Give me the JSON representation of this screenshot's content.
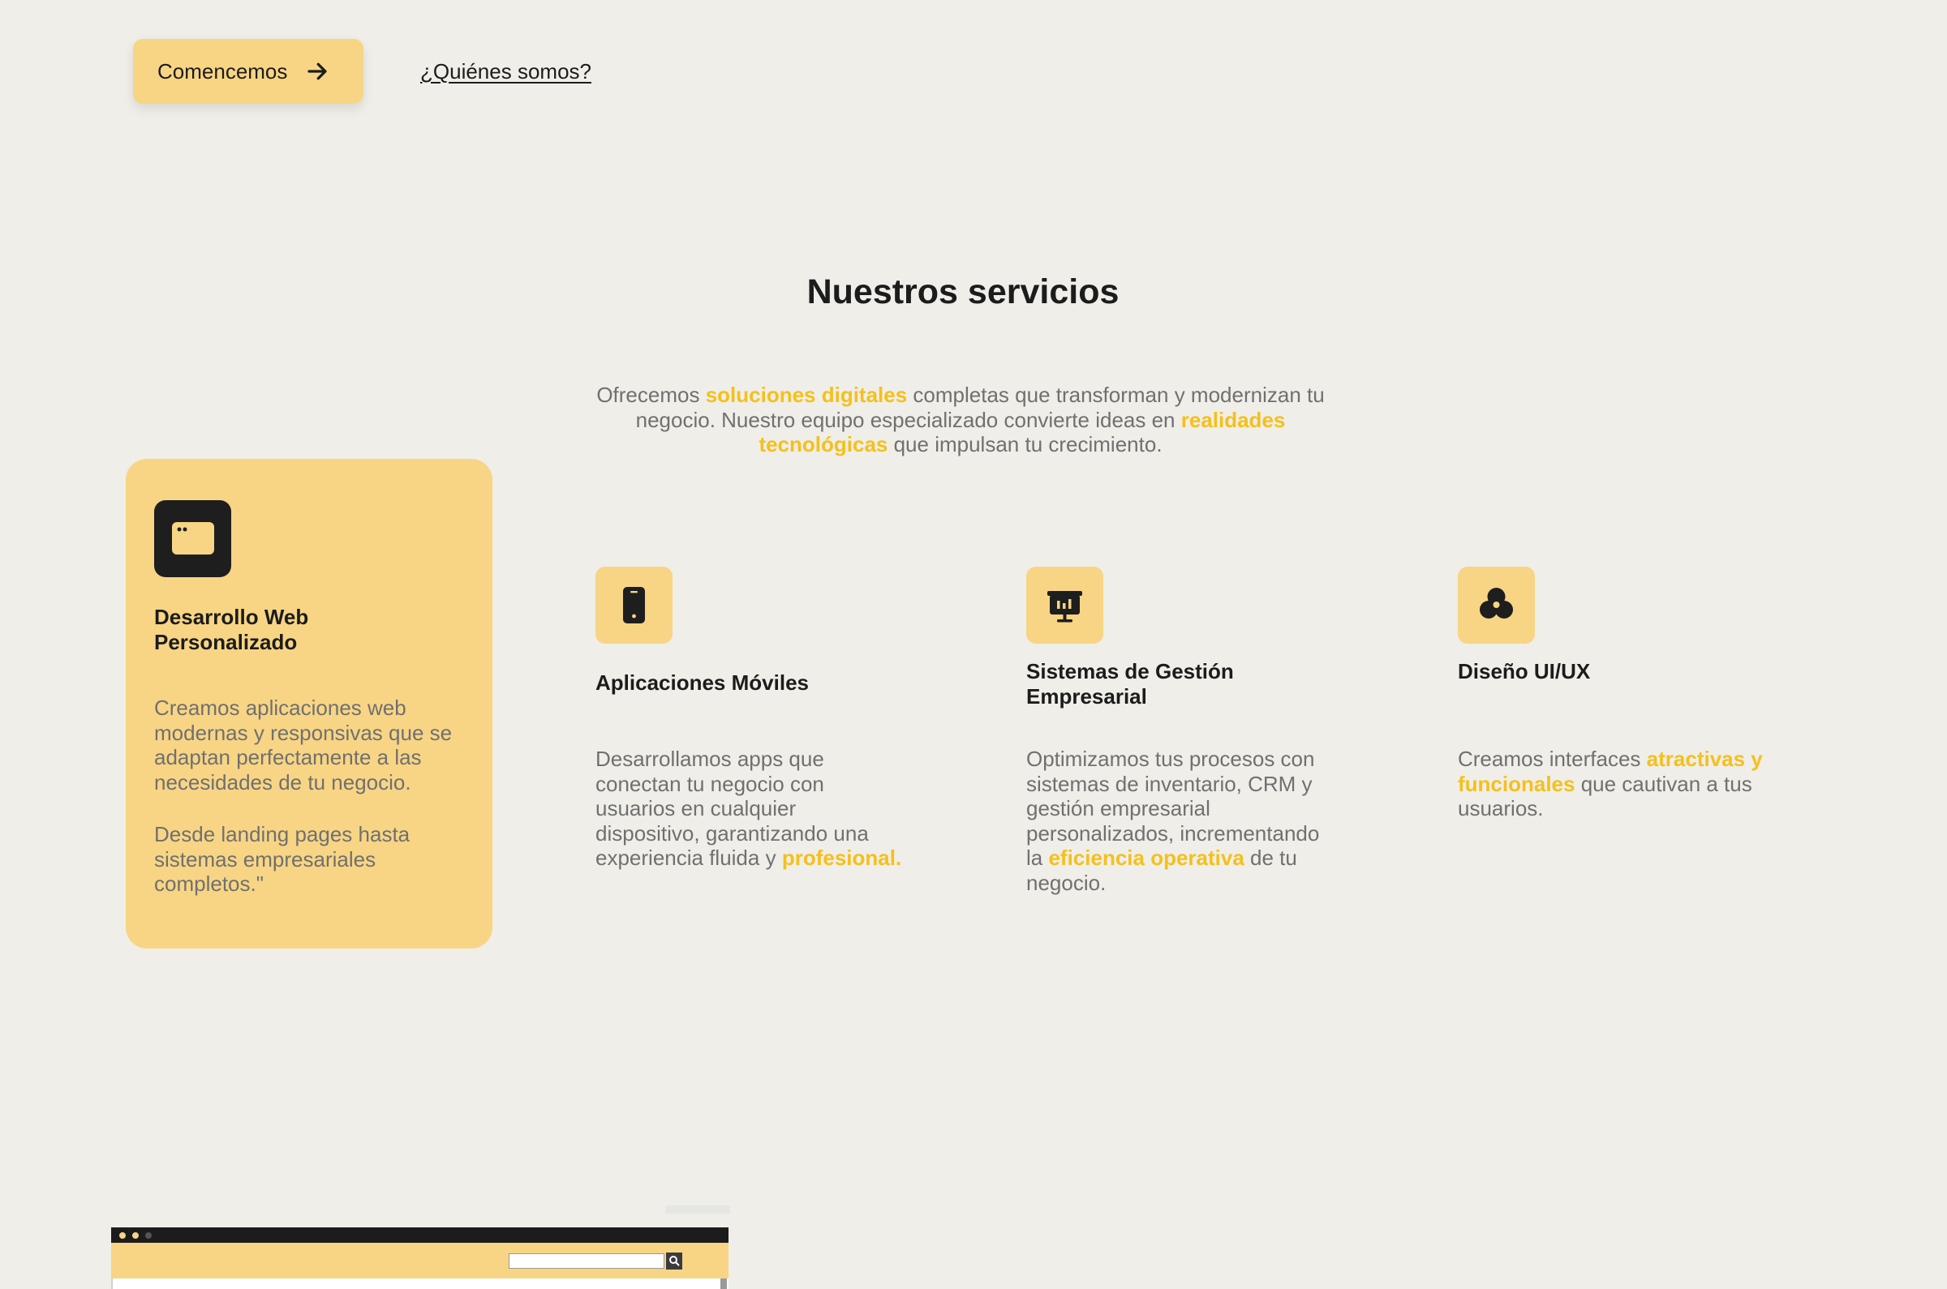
{
  "hero": {
    "primary_button": "Comencemos",
    "secondary_link": "¿Quiénes somos?"
  },
  "services": {
    "title": "Nuestros servicios",
    "intro": {
      "t1": "Ofrecemos ",
      "h1": "soluciones digitales",
      "t2": " completas que transforman y modernizan tu negocio. Nuestro equipo especializado convierte ideas en ",
      "h2": "realidades tecnológicas",
      "t3": " que impulsan tu crecimiento."
    },
    "items": [
      {
        "icon": "browser-window-icon",
        "title": "Desarrollo Web Personalizado",
        "desc1": "Creamos aplicaciones web modernas y responsivas que se adaptan perfectamente a las necesidades de tu negocio.",
        "desc2": "Desde landing pages hasta sistemas empresariales completos.\""
      },
      {
        "icon": "mobile-phone-icon",
        "title": "Aplicaciones Móviles",
        "t1": "Desarrollamos apps que conectan tu negocio con usuarios en cualquier dispositivo, garantizando una experiencia fluida y ",
        "h1": "profesional."
      },
      {
        "icon": "presentation-chart-icon",
        "title": "Sistemas de Gestión Empresarial",
        "t1": "Optimizamos tus procesos con sistemas de inventario, CRM y gestión empresarial personalizados, incrementando la ",
        "h1": "eficiencia operativa",
        "t2": " de tu negocio."
      },
      {
        "icon": "design-shapes-icon",
        "title": "Diseño UI/UX",
        "t1": "Creamos interfaces ",
        "h1": "atractivas y funcionales",
        "t2": " que cautivan a tus usuarios."
      }
    ]
  },
  "colors": {
    "background": "#efeee8",
    "accent": "#f8d584",
    "highlight": "#f5c01c",
    "text_dark": "#1c1c1c",
    "text_muted": "#707070"
  }
}
